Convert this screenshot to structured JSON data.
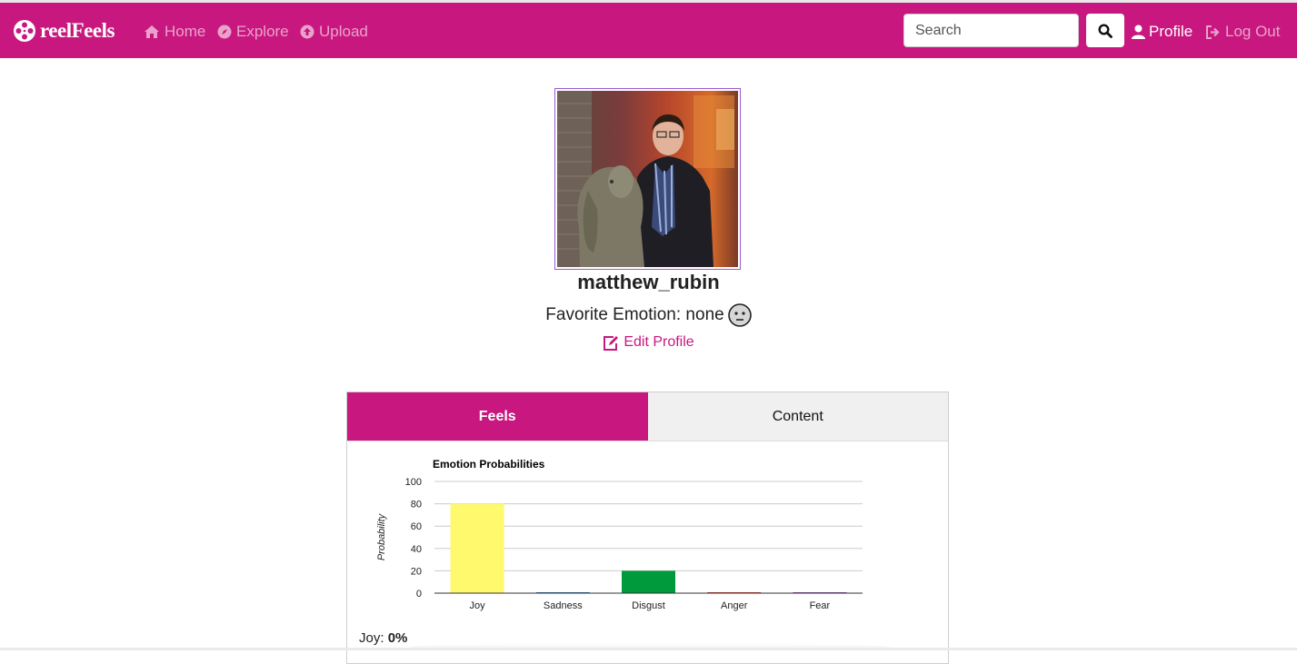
{
  "navbar": {
    "brand": "reelFeels",
    "links": [
      {
        "label": "Home",
        "icon": "home-icon"
      },
      {
        "label": "Explore",
        "icon": "compass-icon"
      },
      {
        "label": "Upload",
        "icon": "upload-icon"
      }
    ],
    "search_placeholder": "Search",
    "profile_label": "Profile",
    "logout_label": "Log Out"
  },
  "colors": {
    "brand": "#c8187f",
    "joy": "#fff96e",
    "sadness": "#1e6fb8",
    "disgust": "#009a3d",
    "anger": "#d62b1f",
    "fear": "#8e44ad"
  },
  "profile": {
    "username": "matthew_rubin",
    "favorite_emotion_label": "Favorite Emotion: none",
    "edit_label": "Edit Profile"
  },
  "tabs": [
    "Feels",
    "Content"
  ],
  "chart_data": {
    "type": "bar",
    "title": "Emotion Probabilities",
    "ylabel": "Probability",
    "xlabel": "",
    "categories": [
      "Joy",
      "Sadness",
      "Disgust",
      "Anger",
      "Fear"
    ],
    "values": [
      80,
      0.5,
      20,
      0.5,
      0.5
    ],
    "ylim": [
      0,
      100
    ],
    "yticks": [
      0,
      20,
      40,
      60,
      80,
      100
    ],
    "grid": true
  },
  "stats": {
    "joy_label": "Joy:",
    "joy_value": "0%"
  }
}
